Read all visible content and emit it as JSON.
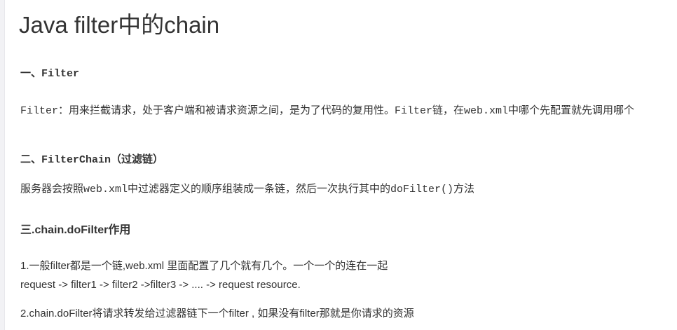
{
  "title": "Java filter中的chain",
  "section1": {
    "heading": "一、Filter",
    "text": "Filter：用来拦截请求，处于客户端和被请求资源之间，是为了代码的复用性。Filter链，在web.xml中哪个先配置就先调用哪个"
  },
  "section2": {
    "heading": "二、FilterChain（过滤链）",
    "text": "服务器会按照web.xml中过滤器定义的顺序组装成一条链，然后一次执行其中的doFilter()方法"
  },
  "section3": {
    "heading": "三.chain.doFilter作用",
    "item1_line1": "1.一般filter都是一个链,web.xml 里面配置了几个就有几个。一个一个的连在一起",
    "item1_line2": "request -> filter1 -> filter2 ->filter3 -> .... -> request resource.",
    "item2": "2.chain.doFilter将请求转发给过滤器链下一个filter , 如果没有filter那就是你请求的资源"
  }
}
